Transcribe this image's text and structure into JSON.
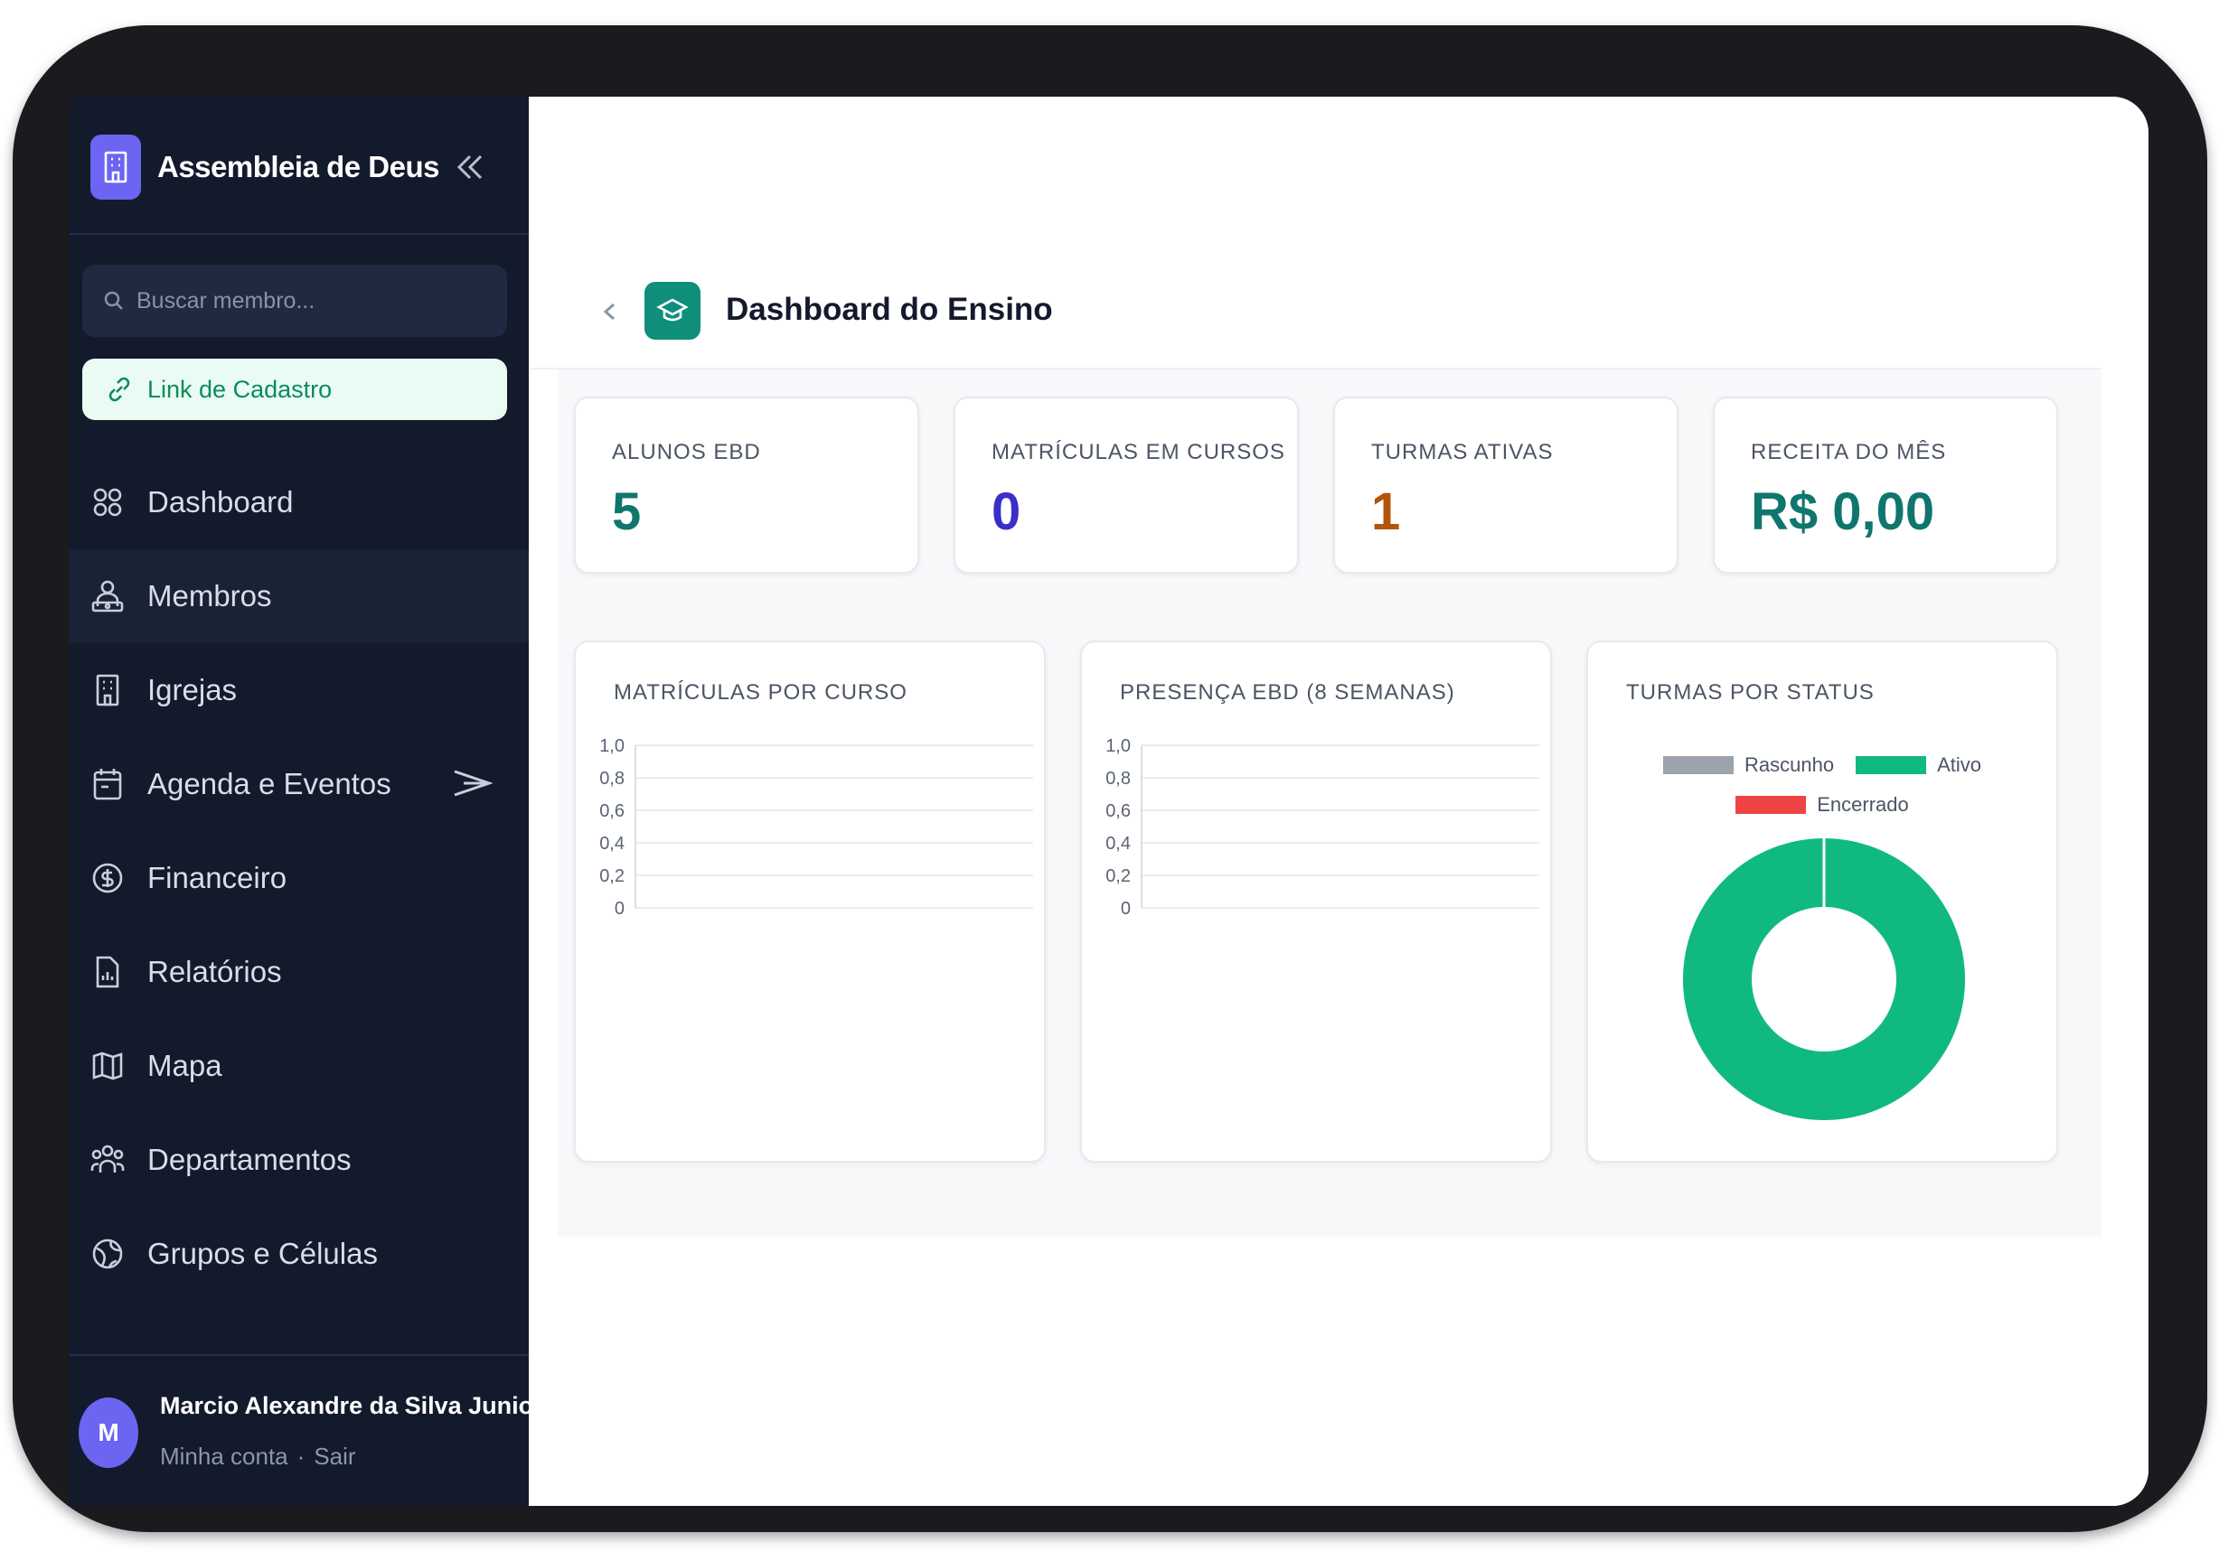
{
  "sidebar": {
    "brand": "Assembleia de Deus",
    "search_placeholder": "Buscar membro...",
    "cadastro_link": "Link de Cadastro",
    "items": [
      {
        "label": "Dashboard",
        "icon": "dashboard-icon"
      },
      {
        "label": "Membros",
        "icon": "members-icon",
        "active": true
      },
      {
        "label": "Igrejas",
        "icon": "building-icon"
      },
      {
        "label": "Agenda e Eventos",
        "icon": "calendar-icon"
      },
      {
        "label": "Financeiro",
        "icon": "dollar-icon"
      },
      {
        "label": "Relatórios",
        "icon": "report-icon"
      },
      {
        "label": "Mapa",
        "icon": "map-icon"
      },
      {
        "label": "Departamentos",
        "icon": "departments-icon"
      },
      {
        "label": "Grupos e Células",
        "icon": "globe-icon"
      }
    ],
    "user": {
      "initial": "M",
      "name": "Marcio Alexandre da Silva Junior",
      "account": "Minha conta",
      "separator": "·",
      "logout": "Sair"
    }
  },
  "header": {
    "title": "Dashboard do Ensino"
  },
  "stats": [
    {
      "label": "ALUNOS EBD",
      "value": "5",
      "color": "#0f766e"
    },
    {
      "label": "MATRÍCULAS EM CURSOS",
      "value": "0",
      "color": "#3b2fc9"
    },
    {
      "label": "TURMAS ATIVAS",
      "value": "1",
      "color": "#b45309"
    },
    {
      "label": "RECEITA DO MÊS",
      "value": "R$ 0,00",
      "color": "#0f766e"
    }
  ],
  "chart_data": [
    {
      "type": "bar",
      "title": "MATRÍCULAS POR CURSO",
      "categories": [],
      "values": [],
      "ylim": [
        0,
        1
      ],
      "yticks": [
        "1,0",
        "0,8",
        "0,6",
        "0,4",
        "0,2",
        "0"
      ],
      "grid": true
    },
    {
      "type": "line",
      "title": "PRESENÇA EBD (8 SEMANAS)",
      "x": [],
      "values": [],
      "ylim": [
        0,
        1
      ],
      "yticks": [
        "1,0",
        "0,8",
        "0,6",
        "0,4",
        "0,2",
        "0"
      ],
      "grid": true
    },
    {
      "type": "pie",
      "title": "TURMAS POR STATUS",
      "legend_position": "top",
      "series": [
        {
          "name": "Rascunho",
          "value": 0,
          "color": "#9ca3af"
        },
        {
          "name": "Ativo",
          "value": 1,
          "color": "#10b981"
        },
        {
          "name": "Encerrado",
          "value": 0,
          "color": "#ef4444"
        }
      ]
    }
  ]
}
